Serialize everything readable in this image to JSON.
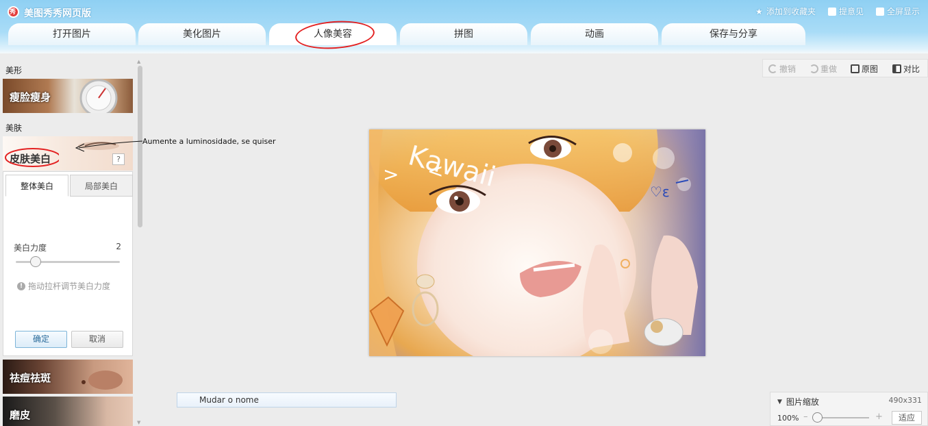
{
  "app": {
    "title": "美图秀秀网页版"
  },
  "top_actions": [
    {
      "icon": "star-icon",
      "label": "添加到收藏夹"
    },
    {
      "icon": "feedback-icon",
      "label": "提意见"
    },
    {
      "icon": "fullscreen-icon",
      "label": "全屏显示"
    }
  ],
  "tabs": [
    "打开图片",
    "美化图片",
    "人像美容",
    "拼图",
    "动画",
    "保存与分享"
  ],
  "active_tab": "人像美容",
  "left": {
    "section_shape": "美形",
    "slim_label": "瘦脸瘦身",
    "section_skin": "美肤",
    "whiten_label": "皮肤美白",
    "help": "?",
    "subtabs": [
      "整体美白",
      "局部美白"
    ],
    "slider": {
      "label": "美白力度",
      "value": "2"
    },
    "hint": "拖动拉杆调节美白力度",
    "ok": "确定",
    "cancel": "取消",
    "acne_label": "祛痘祛斑",
    "smooth_label": "磨皮"
  },
  "toolbar": {
    "undo": "撤销",
    "redo": "重做",
    "original": "原图",
    "compare": "对比"
  },
  "annotation": "Aumente a luminosidade, se quiser",
  "photo_text": "Kawaii",
  "rename": "Mudar o nome",
  "zoom": {
    "title": "图片缩放",
    "dims": "490x331",
    "percent": "100%",
    "fit": "适应",
    "minus": "–",
    "plus": "+"
  },
  "colors": {
    "header": "#8fd0f3",
    "accent_red": "#e32121",
    "link_blue": "#2a6b9a"
  }
}
